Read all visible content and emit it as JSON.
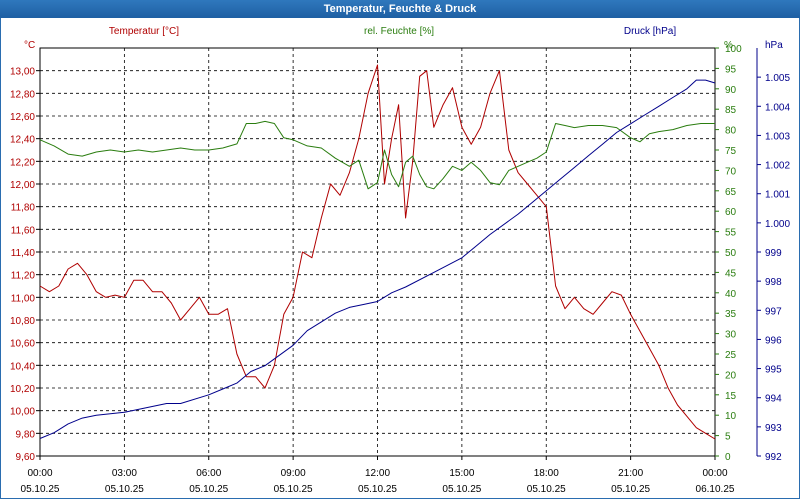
{
  "window": {
    "title": "Temperatur, Feuchte & Druck"
  },
  "colors": {
    "temperature": "#b00000",
    "humidity": "#2a7d0f",
    "pressure": "#00008b",
    "grid": "#000000",
    "title_bg": "#1e5fa3"
  },
  "chart_data": {
    "type": "line",
    "title": "Temperatur, Feuchte & Druck",
    "grid": true,
    "x_ticks": [
      {
        "time": "00:00",
        "date": "05.10.25"
      },
      {
        "time": "03:00",
        "date": "05.10.25"
      },
      {
        "time": "06:00",
        "date": "05.10.25"
      },
      {
        "time": "09:00",
        "date": "05.10.25"
      },
      {
        "time": "12:00",
        "date": "05.10.25"
      },
      {
        "time": "15:00",
        "date": "05.10.25"
      },
      {
        "time": "18:00",
        "date": "05.10.25"
      },
      {
        "time": "21:00",
        "date": "05.10.25"
      },
      {
        "time": "00:00",
        "date": "06.10.25"
      }
    ],
    "xlim": [
      "05.10.25 00:00",
      "06.10.25 00:00"
    ],
    "axes": {
      "temperature": {
        "label": "Temperatur [°C]",
        "unit": "°C",
        "ylim": [
          9.6,
          13.2
        ],
        "ticks": [
          "13,00",
          "12,80",
          "12,60",
          "12,40",
          "12,20",
          "12,00",
          "11,80",
          "11,60",
          "11,40",
          "11,20",
          "11,00",
          "10,80",
          "10,60",
          "10,40",
          "10,20",
          "10,00",
          "9,80",
          "9,60"
        ]
      },
      "humidity": {
        "label": "rel. Feuchte [%]",
        "unit": "%",
        "ylim": [
          0,
          100
        ],
        "ticks": [
          "100",
          "95",
          "90",
          "85",
          "80",
          "75",
          "70",
          "65",
          "60",
          "55",
          "50",
          "45",
          "40",
          "35",
          "30",
          "25",
          "20",
          "15",
          "10",
          "5",
          "0"
        ]
      },
      "pressure": {
        "label": "Druck [hPa]",
        "unit": "hPa",
        "ylim": [
          992,
          1006
        ],
        "ticks": [
          "1.005",
          "1.004",
          "1.003",
          "1.002",
          "1.001",
          "1.000",
          "999",
          "998",
          "997",
          "996",
          "995",
          "994",
          "993",
          "992"
        ]
      }
    },
    "series": [
      {
        "name": "Temperatur [°C]",
        "axis": "temperature",
        "points": [
          [
            "05.10.25 00:00",
            11.1
          ],
          [
            "05.10.25 00:20",
            11.05
          ],
          [
            "05.10.25 00:40",
            11.1
          ],
          [
            "05.10.25 01:00",
            11.25
          ],
          [
            "05.10.25 01:20",
            11.3
          ],
          [
            "05.10.25 01:40",
            11.2
          ],
          [
            "05.10.25 02:00",
            11.05
          ],
          [
            "05.10.25 02:20",
            11.0
          ],
          [
            "05.10.25 02:40",
            11.02
          ],
          [
            "05.10.25 03:00",
            11.0
          ],
          [
            "05.10.25 03:20",
            11.15
          ],
          [
            "05.10.25 03:40",
            11.15
          ],
          [
            "05.10.25 04:00",
            11.05
          ],
          [
            "05.10.25 04:20",
            11.05
          ],
          [
            "05.10.25 04:40",
            10.95
          ],
          [
            "05.10.25 05:00",
            10.8
          ],
          [
            "05.10.25 05:20",
            10.9
          ],
          [
            "05.10.25 05:40",
            11.0
          ],
          [
            "05.10.25 06:00",
            10.85
          ],
          [
            "05.10.25 06:20",
            10.85
          ],
          [
            "05.10.25 06:40",
            10.9
          ],
          [
            "05.10.25 07:00",
            10.5
          ],
          [
            "05.10.25 07:20",
            10.3
          ],
          [
            "05.10.25 07:40",
            10.3
          ],
          [
            "05.10.25 08:00",
            10.2
          ],
          [
            "05.10.25 08:20",
            10.4
          ],
          [
            "05.10.25 08:40",
            10.85
          ],
          [
            "05.10.25 09:00",
            11.0
          ],
          [
            "05.10.25 09:20",
            11.4
          ],
          [
            "05.10.25 09:40",
            11.35
          ],
          [
            "05.10.25 10:00",
            11.7
          ],
          [
            "05.10.25 10:20",
            12.0
          ],
          [
            "05.10.25 10:40",
            11.9
          ],
          [
            "05.10.25 11:00",
            12.1
          ],
          [
            "05.10.25 11:20",
            12.4
          ],
          [
            "05.10.25 11:40",
            12.8
          ],
          [
            "05.10.25 12:00",
            13.05
          ],
          [
            "05.10.25 12:15",
            12.0
          ],
          [
            "05.10.25 12:30",
            12.4
          ],
          [
            "05.10.25 12:45",
            12.7
          ],
          [
            "05.10.25 13:00",
            11.7
          ],
          [
            "05.10.25 13:15",
            12.2
          ],
          [
            "05.10.25 13:30",
            12.95
          ],
          [
            "05.10.25 13:45",
            13.0
          ],
          [
            "05.10.25 14:00",
            12.5
          ],
          [
            "05.10.25 14:20",
            12.7
          ],
          [
            "05.10.25 14:40",
            12.85
          ],
          [
            "05.10.25 15:00",
            12.5
          ],
          [
            "05.10.25 15:20",
            12.35
          ],
          [
            "05.10.25 15:40",
            12.5
          ],
          [
            "05.10.25 16:00",
            12.8
          ],
          [
            "05.10.25 16:20",
            13.0
          ],
          [
            "05.10.25 16:40",
            12.3
          ],
          [
            "05.10.25 17:00",
            12.1
          ],
          [
            "05.10.25 17:20",
            12.0
          ],
          [
            "05.10.25 17:40",
            11.9
          ],
          [
            "05.10.25 18:00",
            11.8
          ],
          [
            "05.10.25 18:20",
            11.1
          ],
          [
            "05.10.25 18:40",
            10.9
          ],
          [
            "05.10.25 19:00",
            11.0
          ],
          [
            "05.10.25 19:20",
            10.9
          ],
          [
            "05.10.25 19:40",
            10.85
          ],
          [
            "05.10.25 20:00",
            10.95
          ],
          [
            "05.10.25 20:20",
            11.05
          ],
          [
            "05.10.25 20:40",
            11.02
          ],
          [
            "05.10.25 21:00",
            10.85
          ],
          [
            "05.10.25 21:20",
            10.7
          ],
          [
            "05.10.25 21:40",
            10.55
          ],
          [
            "05.10.25 22:00",
            10.4
          ],
          [
            "05.10.25 22:20",
            10.2
          ],
          [
            "05.10.25 22:40",
            10.05
          ],
          [
            "05.10.25 23:00",
            9.95
          ],
          [
            "05.10.25 23:20",
            9.85
          ],
          [
            "05.10.25 23:40",
            9.8
          ],
          [
            "06.10.25 00:00",
            9.75
          ]
        ]
      },
      {
        "name": "rel. Feuchte [%]",
        "axis": "humidity",
        "points": [
          [
            "05.10.25 00:00",
            77.5
          ],
          [
            "05.10.25 00:30",
            76.0
          ],
          [
            "05.10.25 01:00",
            74.0
          ],
          [
            "05.10.25 01:30",
            73.5
          ],
          [
            "05.10.25 02:00",
            74.5
          ],
          [
            "05.10.25 02:30",
            75.0
          ],
          [
            "05.10.25 03:00",
            74.5
          ],
          [
            "05.10.25 03:30",
            75.0
          ],
          [
            "05.10.25 04:00",
            74.5
          ],
          [
            "05.10.25 04:30",
            75.0
          ],
          [
            "05.10.25 05:00",
            75.5
          ],
          [
            "05.10.25 05:30",
            75.0
          ],
          [
            "05.10.25 06:00",
            75.0
          ],
          [
            "05.10.25 06:30",
            75.5
          ],
          [
            "05.10.25 07:00",
            76.5
          ],
          [
            "05.10.25 07:20",
            81.5
          ],
          [
            "05.10.25 07:40",
            81.5
          ],
          [
            "05.10.25 08:00",
            82.0
          ],
          [
            "05.10.25 08:20",
            81.5
          ],
          [
            "05.10.25 08:40",
            78.0
          ],
          [
            "05.10.25 09:00",
            77.5
          ],
          [
            "05.10.25 09:30",
            76.0
          ],
          [
            "05.10.25 10:00",
            75.5
          ],
          [
            "05.10.25 10:30",
            73.0
          ],
          [
            "05.10.25 11:00",
            71.0
          ],
          [
            "05.10.25 11:20",
            72.5
          ],
          [
            "05.10.25 11:40",
            65.5
          ],
          [
            "05.10.25 12:00",
            67.0
          ],
          [
            "05.10.25 12:15",
            75.0
          ],
          [
            "05.10.25 12:30",
            69.0
          ],
          [
            "05.10.25 12:45",
            66.0
          ],
          [
            "05.10.25 13:00",
            72.0
          ],
          [
            "05.10.25 13:15",
            73.5
          ],
          [
            "05.10.25 13:30",
            69.0
          ],
          [
            "05.10.25 13:45",
            66.0
          ],
          [
            "05.10.25 14:00",
            65.5
          ],
          [
            "05.10.25 14:20",
            68.0
          ],
          [
            "05.10.25 14:40",
            71.0
          ],
          [
            "05.10.25 15:00",
            70.0
          ],
          [
            "05.10.25 15:20",
            72.0
          ],
          [
            "05.10.25 15:40",
            70.0
          ],
          [
            "05.10.25 16:00",
            67.0
          ],
          [
            "05.10.25 16:20",
            66.5
          ],
          [
            "05.10.25 16:40",
            70.0
          ],
          [
            "05.10.25 17:00",
            71.0
          ],
          [
            "05.10.25 17:20",
            72.0
          ],
          [
            "05.10.25 17:40",
            73.0
          ],
          [
            "05.10.25 18:00",
            74.5
          ],
          [
            "05.10.25 18:20",
            81.5
          ],
          [
            "05.10.25 18:40",
            81.0
          ],
          [
            "05.10.25 19:00",
            80.5
          ],
          [
            "05.10.25 19:30",
            81.0
          ],
          [
            "05.10.25 20:00",
            81.0
          ],
          [
            "05.10.25 20:30",
            80.5
          ],
          [
            "05.10.25 21:00",
            78.0
          ],
          [
            "05.10.25 21:20",
            77.0
          ],
          [
            "05.10.25 21:40",
            79.0
          ],
          [
            "05.10.25 22:00",
            79.5
          ],
          [
            "05.10.25 22:30",
            80.0
          ],
          [
            "05.10.25 23:00",
            81.0
          ],
          [
            "05.10.25 23:30",
            81.5
          ],
          [
            "06.10.25 00:00",
            81.5
          ]
        ]
      },
      {
        "name": "Druck [hPa]",
        "axis": "pressure",
        "points": [
          [
            "05.10.25 00:00",
            992.6
          ],
          [
            "05.10.25 00:30",
            992.8
          ],
          [
            "05.10.25 01:00",
            993.1
          ],
          [
            "05.10.25 01:30",
            993.3
          ],
          [
            "05.10.25 02:00",
            993.4
          ],
          [
            "05.10.25 03:00",
            993.5
          ],
          [
            "05.10.25 03:30",
            993.6
          ],
          [
            "05.10.25 04:30",
            993.8
          ],
          [
            "05.10.25 05:00",
            993.8
          ],
          [
            "05.10.25 06:00",
            994.1
          ],
          [
            "05.10.25 06:30",
            994.3
          ],
          [
            "05.10.25 07:00",
            994.5
          ],
          [
            "05.10.25 07:30",
            994.9
          ],
          [
            "05.10.25 08:00",
            995.1
          ],
          [
            "05.10.25 09:00",
            995.8
          ],
          [
            "05.10.25 09:30",
            996.3
          ],
          [
            "05.10.25 10:00",
            996.6
          ],
          [
            "05.10.25 10:30",
            996.9
          ],
          [
            "05.10.25 11:00",
            997.1
          ],
          [
            "05.10.25 11:30",
            997.2
          ],
          [
            "05.10.25 12:00",
            997.3
          ],
          [
            "05.10.25 12:30",
            997.6
          ],
          [
            "05.10.25 13:00",
            997.8
          ],
          [
            "05.10.25 14:00",
            998.3
          ],
          [
            "05.10.25 15:00",
            998.8
          ],
          [
            "05.10.25 15:30",
            999.2
          ],
          [
            "05.10.25 16:00",
            999.6
          ],
          [
            "05.10.25 17:00",
            1000.3
          ],
          [
            "05.10.25 17:30",
            1000.7
          ],
          [
            "05.10.25 18:00",
            1001.1
          ],
          [
            "05.10.25 18:30",
            1001.5
          ],
          [
            "05.10.25 19:00",
            1001.9
          ],
          [
            "05.10.25 19:30",
            1002.3
          ],
          [
            "05.10.25 20:00",
            1002.7
          ],
          [
            "05.10.25 20:30",
            1003.1
          ],
          [
            "05.10.25 21:00",
            1003.4
          ],
          [
            "05.10.25 21:30",
            1003.7
          ],
          [
            "05.10.25 22:00",
            1004.0
          ],
          [
            "05.10.25 22:30",
            1004.3
          ],
          [
            "05.10.25 23:00",
            1004.6
          ],
          [
            "05.10.25 23:20",
            1004.9
          ],
          [
            "05.10.25 23:40",
            1004.9
          ],
          [
            "06.10.25 00:00",
            1004.8
          ]
        ]
      }
    ]
  }
}
